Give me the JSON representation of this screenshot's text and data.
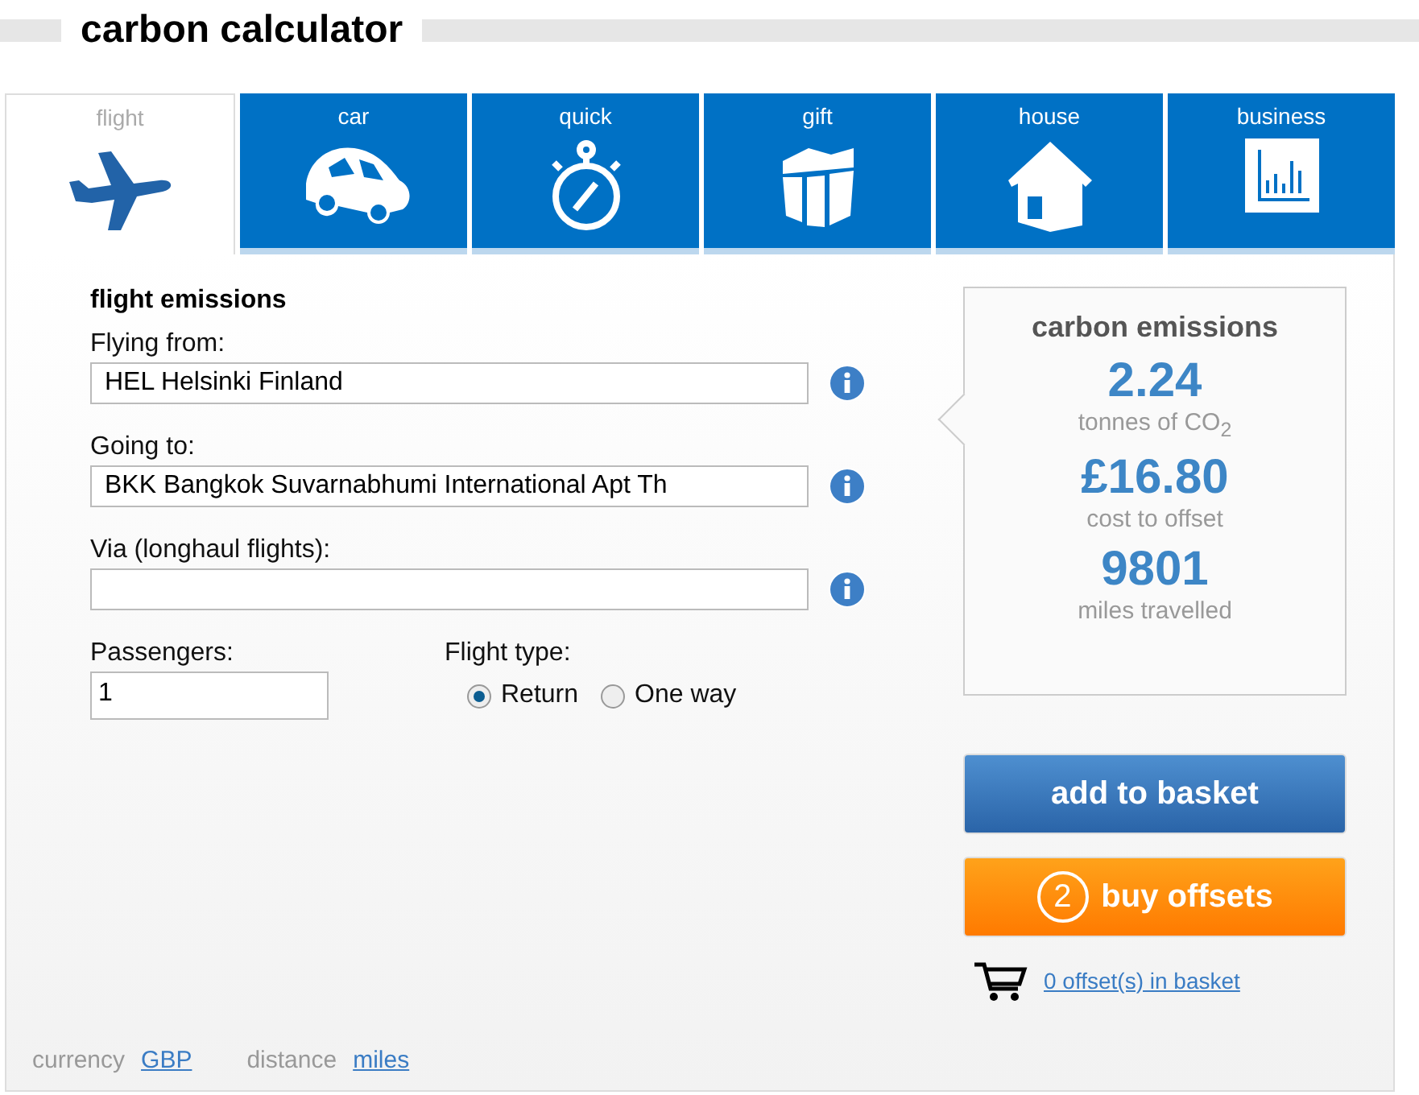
{
  "title": "carbon calculator",
  "tabs": [
    {
      "label": "flight",
      "selected": true
    },
    {
      "label": "car",
      "selected": false
    },
    {
      "label": "quick",
      "selected": false
    },
    {
      "label": "gift",
      "selected": false
    },
    {
      "label": "house",
      "selected": false
    },
    {
      "label": "business",
      "selected": false
    }
  ],
  "form": {
    "heading": "flight emissions",
    "fields": [
      {
        "label": "Flying from:",
        "value": "HEL Helsinki Finland"
      },
      {
        "label": "Going to:",
        "value": "BKK Bangkok Suvarnabhumi International Apt Th"
      },
      {
        "label": "Via (longhaul flights):"
      }
    ],
    "passengers": {
      "label": "Passengers:",
      "value": "1"
    },
    "flight_type": {
      "label": "Flight type:",
      "options": [
        {
          "label": "Return",
          "selected": true
        },
        {
          "label": "One way",
          "selected": false
        }
      ]
    }
  },
  "results": {
    "heading": "carbon emissions",
    "stats": [
      {
        "value": "2.24",
        "caption": "tonnes of CO$_{2}$"
      },
      {
        "value": "£16.80",
        "caption": "cost to offset"
      },
      {
        "value": "9801",
        "caption": "miles travelled"
      }
    ]
  },
  "add_button": "add to basket",
  "buy_button": {
    "step": "2",
    "label": "buy offsets"
  },
  "basket_link": "0 offset(s) in basket",
  "footer": [
    {
      "label": "currency",
      "link": "GBP"
    },
    {
      "label": "distance",
      "link": "miles"
    }
  ]
}
